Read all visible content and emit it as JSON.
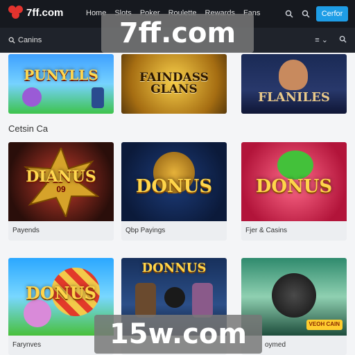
{
  "header": {
    "logo_text": "7ff.com",
    "nav": [
      "Home",
      "Slots",
      "Poker",
      "Roulette",
      "Rewards",
      "Fans"
    ],
    "cta_label": "Cerfor"
  },
  "subbar": {
    "search_label": "Canins"
  },
  "watermarks": {
    "top": "7ff.com",
    "bottom": "15w.com"
  },
  "section": {
    "title": "Cetsin Ca"
  },
  "cards": [
    {
      "title": "PUNYLLS",
      "caption": ""
    },
    {
      "title": "FAINDASS GLANS",
      "caption": ""
    },
    {
      "title": "FLANILES",
      "caption": ""
    },
    {
      "title": "DIANUS",
      "sub": "09",
      "caption": "Payends"
    },
    {
      "title": "DONUS",
      "caption": "Qbp Payings"
    },
    {
      "title": "DONUS",
      "caption": "Fjer & Casins"
    },
    {
      "title": "DONUS",
      "caption": "Farynves"
    },
    {
      "title": "DONNUS",
      "caption": ""
    },
    {
      "title": "",
      "badge": "VEOH CAIN",
      "caption": "oymed"
    }
  ],
  "colors": {
    "topbar_bg": "#16191f",
    "accent": "#1e9de6",
    "brand": "#e2332e"
  }
}
